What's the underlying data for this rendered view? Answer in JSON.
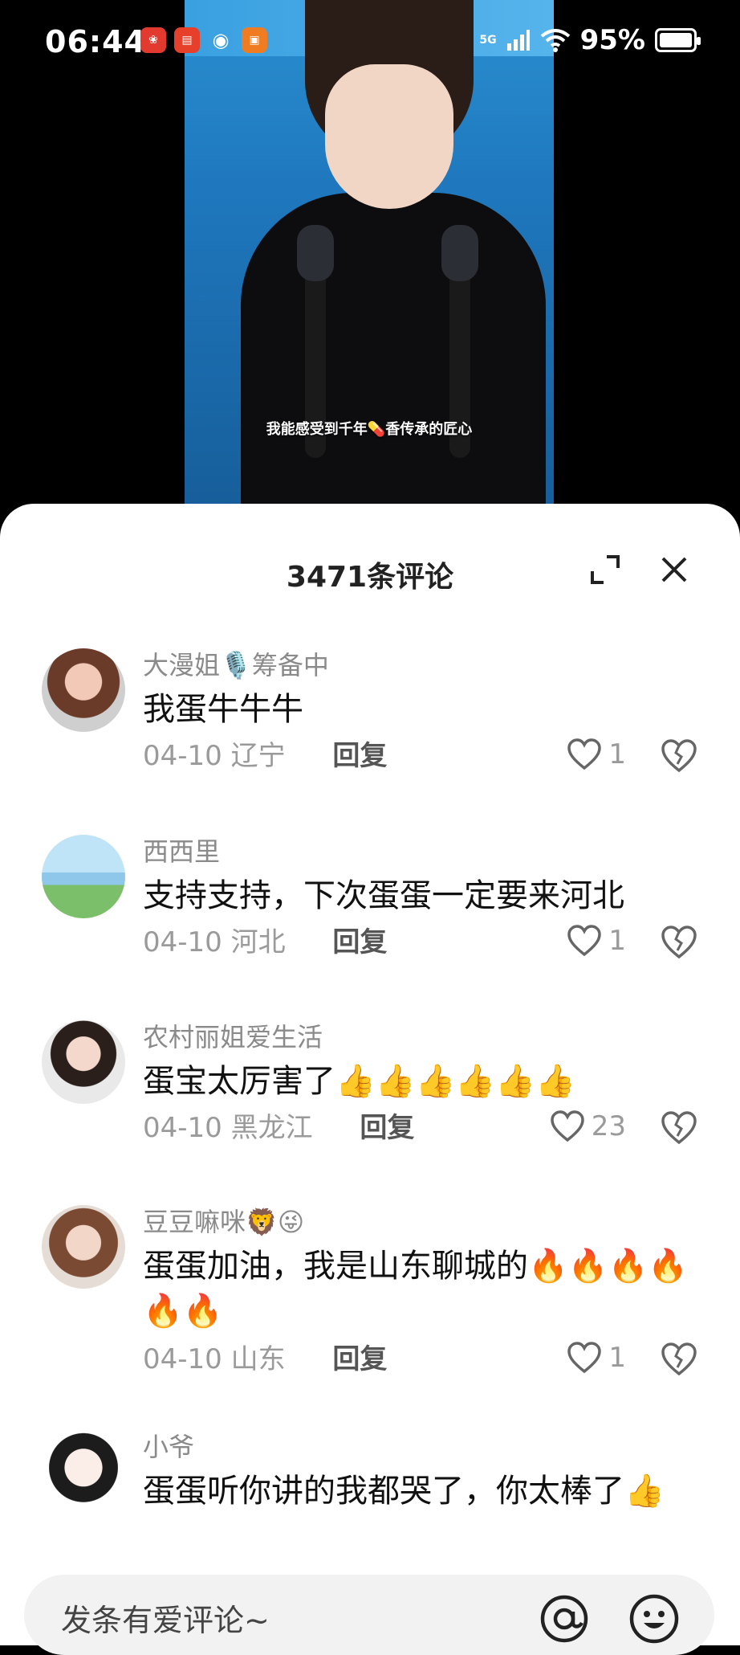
{
  "status_bar": {
    "time": "06:44",
    "network": "5G",
    "battery": "95%",
    "battery_level": 0.95
  },
  "video": {
    "subtitle": "我能感受到千年💊香传承的匠心"
  },
  "sheet": {
    "title": "3471条评论"
  },
  "comments": [
    {
      "user": "大漫姐🎙️筹备中",
      "text": "我蛋牛牛牛",
      "date": "04-10",
      "region": "辽宁",
      "reply": "回复",
      "likes": "1"
    },
    {
      "user": "西西里",
      "text": "支持支持，下次蛋蛋一定要来河北",
      "date": "04-10",
      "region": "河北",
      "reply": "回复",
      "likes": "1"
    },
    {
      "user": "农村丽姐爱生活",
      "text": "蛋宝太厉害了👍👍👍👍👍👍",
      "date": "04-10",
      "region": "黑龙江",
      "reply": "回复",
      "likes": "23"
    },
    {
      "user": "豆豆嘛咪🦁😜",
      "text": "蛋蛋加油，我是山东聊城的🔥🔥🔥🔥🔥🔥",
      "date": "04-10",
      "region": "山东",
      "reply": "回复",
      "likes": "1"
    },
    {
      "user": "小爷",
      "text": "蛋蛋听你讲的我都哭了，你太棒了👍"
    }
  ],
  "input": {
    "placeholder": "发条有爱评论~"
  }
}
